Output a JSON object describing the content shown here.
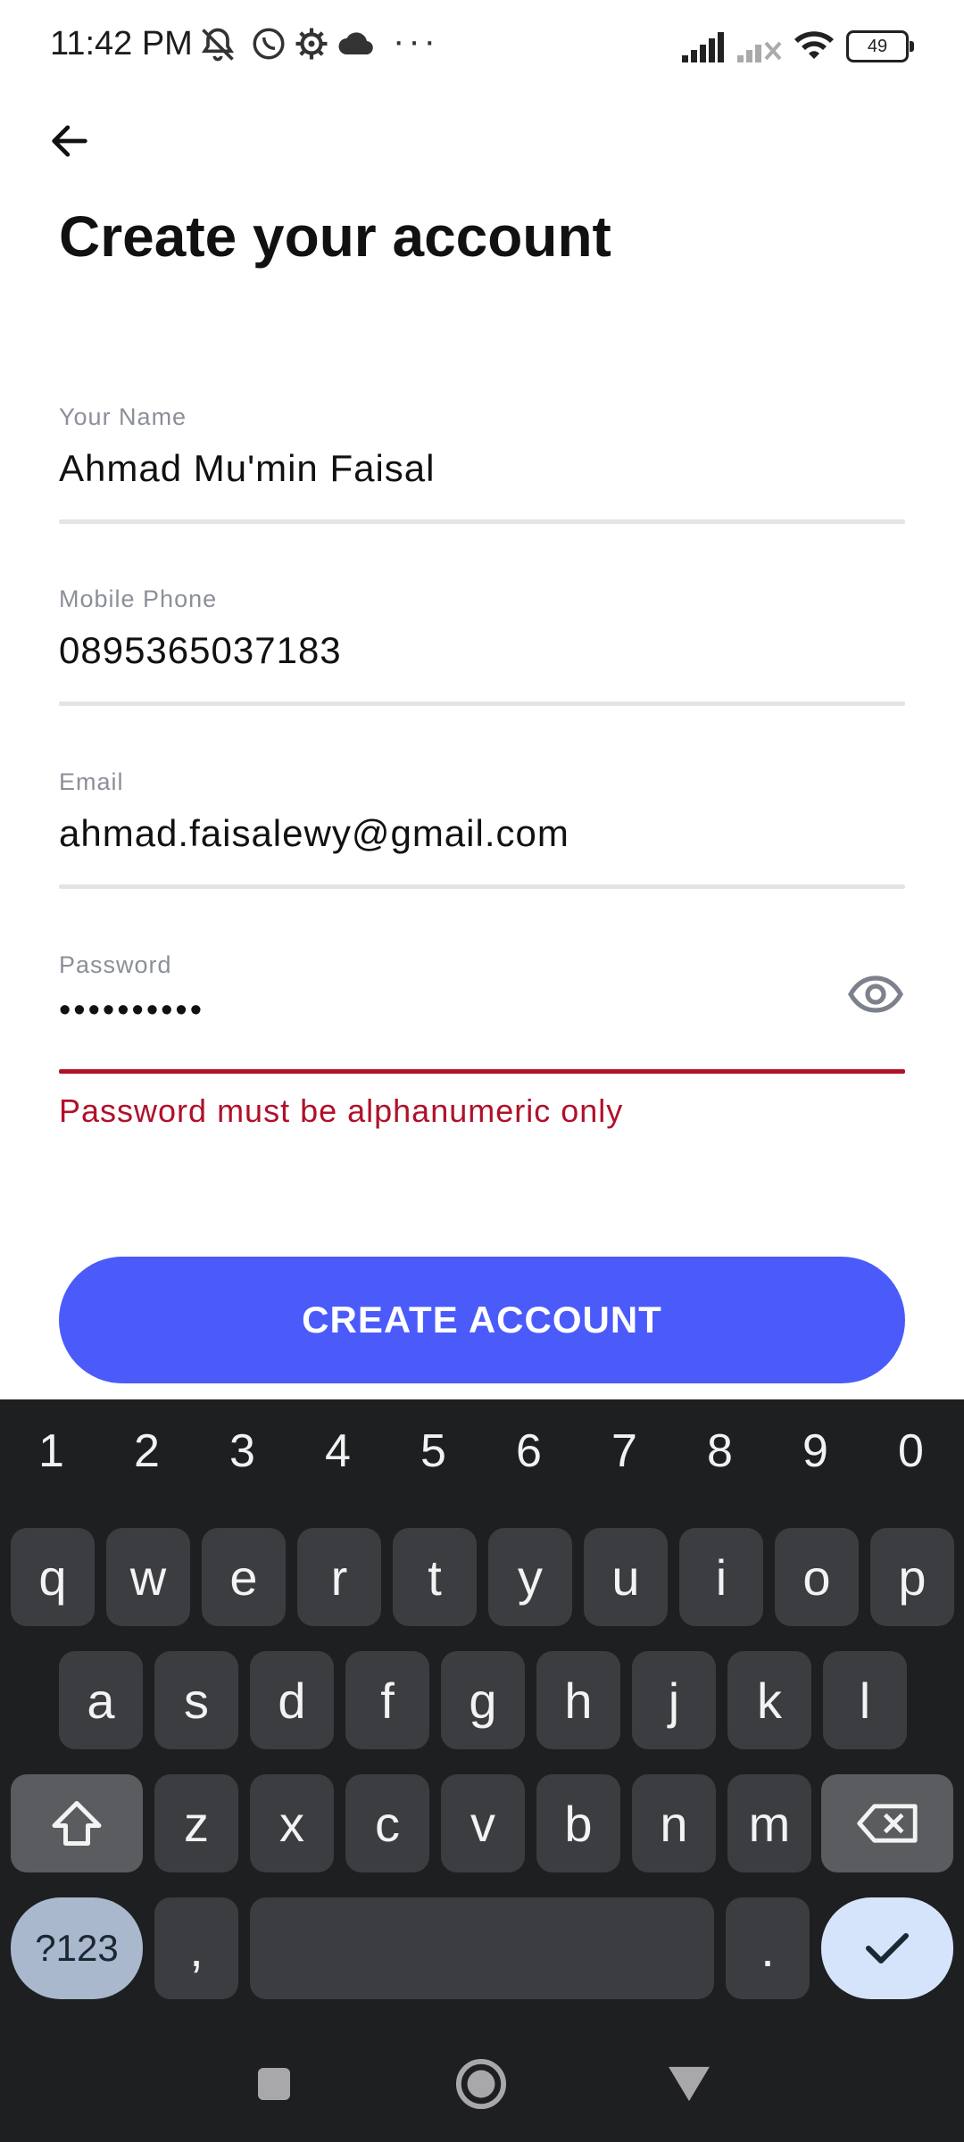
{
  "status_bar": {
    "time": "11:42 PM",
    "battery": "49",
    "more": "···"
  },
  "header": {
    "title": "Create your account"
  },
  "form": {
    "name": {
      "label": "Your Name",
      "value": "Ahmad Mu'min Faisal"
    },
    "phone": {
      "label": "Mobile Phone",
      "value": "0895365037183"
    },
    "email": {
      "label": "Email",
      "value": "ahmad.faisalewy@gmail.com"
    },
    "password": {
      "label": "Password",
      "value": "••••••••••",
      "error": "Password must be alphanumeric only"
    },
    "submit_label": "CREATE ACCOUNT"
  },
  "colors": {
    "accent": "#4a5bfa",
    "error": "#b0112a",
    "keyboard_bg": "#1e1f21"
  },
  "keyboard": {
    "numbers": [
      "1",
      "2",
      "3",
      "4",
      "5",
      "6",
      "7",
      "8",
      "9",
      "0"
    ],
    "row1": [
      "q",
      "w",
      "e",
      "r",
      "t",
      "y",
      "u",
      "i",
      "o",
      "p"
    ],
    "row2": [
      "a",
      "s",
      "d",
      "f",
      "g",
      "h",
      "j",
      "k",
      "l"
    ],
    "row3": [
      "z",
      "x",
      "c",
      "v",
      "b",
      "n",
      "m"
    ],
    "symbols_label": "?123",
    "comma": ",",
    "period": "."
  }
}
